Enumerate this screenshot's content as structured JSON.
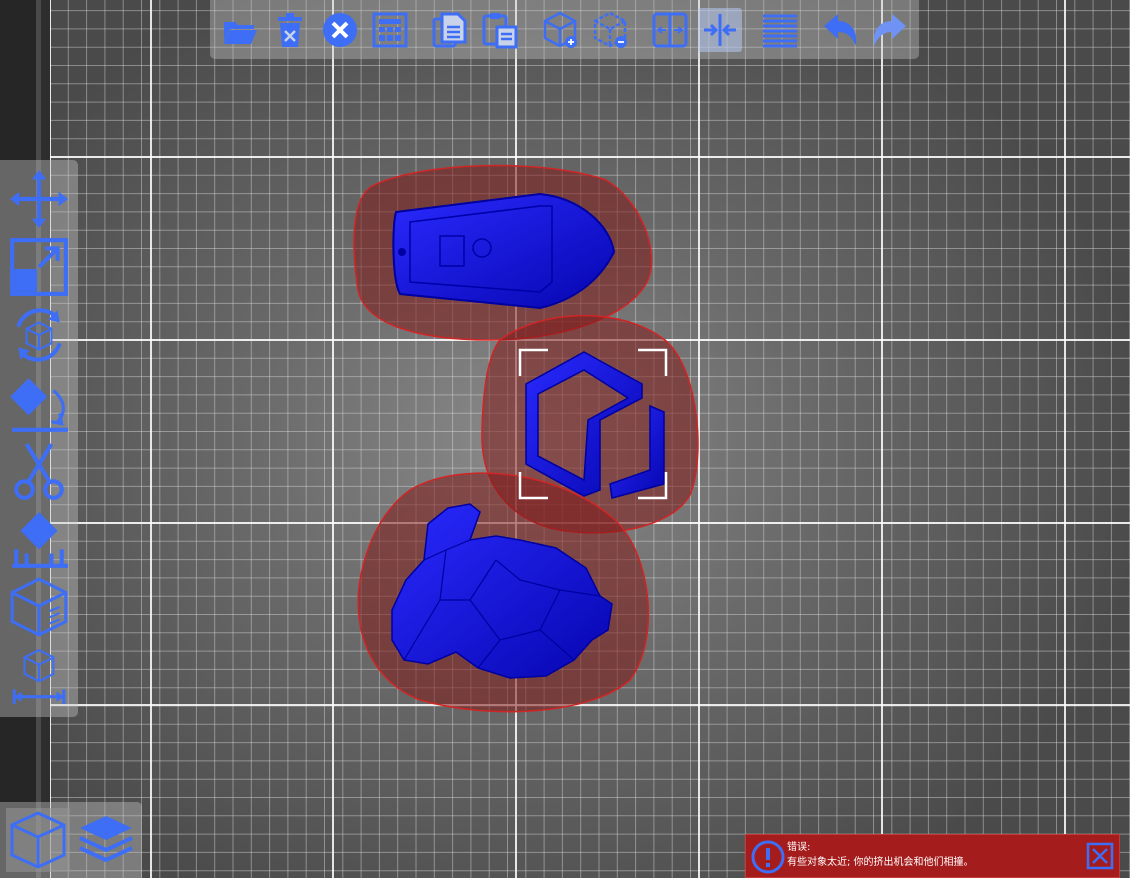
{
  "toolbar": {
    "buttons": [
      {
        "name": "open-file",
        "icon": "folder-open-icon"
      },
      {
        "name": "delete",
        "icon": "trash-icon"
      },
      {
        "name": "clear-all",
        "icon": "close-circle-icon"
      },
      {
        "name": "arrange",
        "icon": "grid-arrange-icon"
      },
      {
        "name": "copy",
        "icon": "copy-icon"
      },
      {
        "name": "paste",
        "icon": "paste-icon"
      },
      {
        "name": "add-object",
        "icon": "cube-plus-icon"
      },
      {
        "name": "remove-object",
        "icon": "cube-minus-icon"
      },
      {
        "name": "split",
        "icon": "split-icon"
      },
      {
        "name": "merge",
        "icon": "merge-icon",
        "active": true
      },
      {
        "name": "layers",
        "icon": "layers-lines-icon"
      },
      {
        "name": "undo",
        "icon": "undo-icon"
      },
      {
        "name": "redo",
        "icon": "redo-icon"
      }
    ]
  },
  "sidebar": {
    "tools": [
      {
        "name": "move",
        "icon": "move-arrows-icon"
      },
      {
        "name": "scale",
        "icon": "scale-icon"
      },
      {
        "name": "rotate",
        "icon": "rotate-cube-icon"
      },
      {
        "name": "lay-flat",
        "icon": "lay-flat-icon"
      },
      {
        "name": "cut",
        "icon": "scissors-icon"
      },
      {
        "name": "support",
        "icon": "support-icon"
      },
      {
        "name": "info",
        "icon": "cube-info-icon"
      },
      {
        "name": "measure",
        "icon": "measure-icon"
      }
    ]
  },
  "viewmode": {
    "buttons": [
      {
        "name": "model-view",
        "icon": "cube-view-icon",
        "active": true
      },
      {
        "name": "layer-view",
        "icon": "layers-stack-icon"
      }
    ]
  },
  "scene": {
    "objects": [
      "boat",
      "logo-cube",
      "bunny"
    ],
    "object_color": "#0a0ad8",
    "conflict_color": "#7a1e1e"
  },
  "error": {
    "title": "错误:",
    "message": "有些对象太近; 你的挤出机会和他们相撞。"
  },
  "colors": {
    "accent": "#3d6ef5",
    "error": "#a51c1c"
  }
}
